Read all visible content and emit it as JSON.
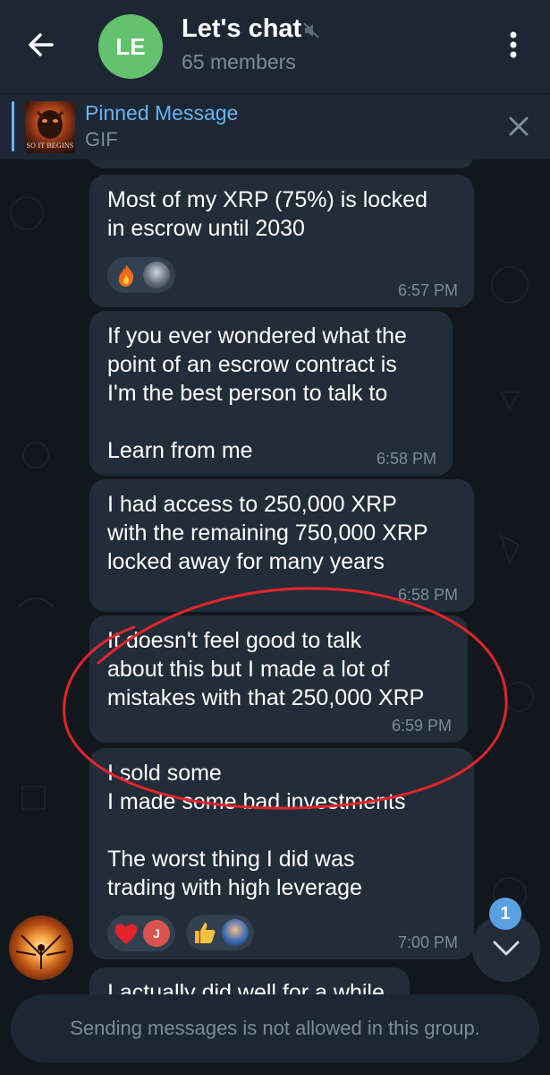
{
  "header": {
    "back_icon": "arrow-left-icon",
    "avatar_initials": "LE",
    "avatar_color": "#62c26d",
    "title": "Let's chat",
    "muted_icon": "muted-speaker-icon",
    "subtitle": "65 members",
    "menu_icon": "more-vertical-icon"
  },
  "pinned": {
    "title": "Pinned Message",
    "subtitle": "GIF",
    "thumb_caption": "SO IT BEGINS",
    "close_icon": "close-icon"
  },
  "messages": [
    {
      "text": "Most of my XRP (75%) is locked\nin escrow until 2030",
      "time": "6:57 PM",
      "reactions": [
        "fire-emoji",
        "user-avatar"
      ]
    },
    {
      "text": "If you ever wondered what the\npoint of an escrow contract is\nI'm the best person to talk to\n\nLearn from me",
      "time": "6:58 PM"
    },
    {
      "text": "I had access to 250,000 XRP\nwith the remaining 750,000 XRP\nlocked away for many years",
      "time": "6:58 PM"
    },
    {
      "text": "It doesn't feel good to talk\nabout this but I made a lot of\nmistakes with that 250,000 XRP",
      "time": "6:59 PM"
    },
    {
      "text": "I sold some\nI made some bad investments\n\nThe worst thing I did was\ntrading with high leverage",
      "time": "7:00 PM",
      "reactions": [
        "heart-emoji",
        "user-avatar-j",
        "thumbs-up-emoji",
        "user-avatar"
      ]
    },
    {
      "text": "I actually did well for a while"
    }
  ],
  "reaction_avatar_letter": "J",
  "scroll": {
    "unread_count": "1",
    "icon": "chevron-down-icon"
  },
  "footer": {
    "notice": "Sending messages is not allowed in this group."
  },
  "colors": {
    "header_bg": "#1d2733",
    "bubble_bg": "#232d39",
    "accent": "#6ab3f3",
    "annotation": "#e0262b"
  }
}
